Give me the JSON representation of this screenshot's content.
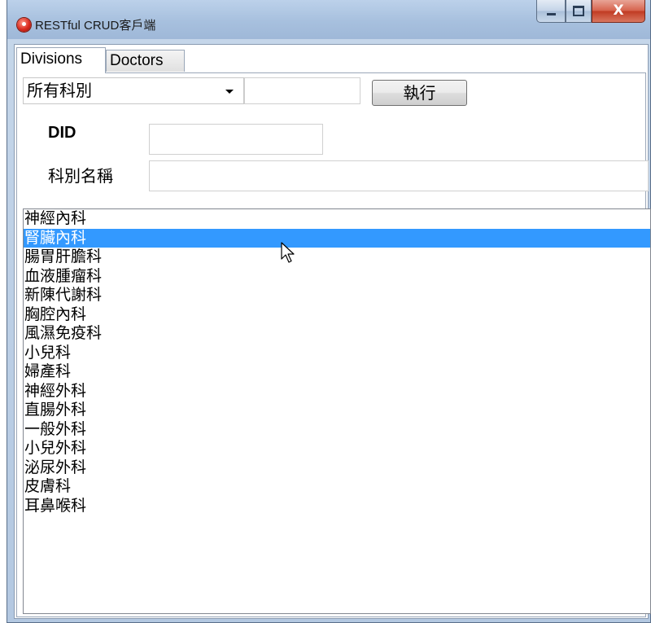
{
  "window": {
    "title": "RESTful CRUD客戶端",
    "controls": {
      "minimize_icon": "minimize-icon",
      "maximize_icon": "maximize-icon",
      "close_label": "X"
    }
  },
  "tabs": [
    {
      "label": "Divisions",
      "active": true
    },
    {
      "label": "Doctors",
      "active": false
    }
  ],
  "toolbar": {
    "division_filter": "所有科別",
    "query_value": "",
    "run_label": "執行"
  },
  "form": {
    "did_label": "DID",
    "did_value": "",
    "name_label": "科別名稱",
    "name_value": ""
  },
  "list": {
    "selected_index": 1,
    "items": [
      "神經內科",
      "腎臟內科",
      "腸胃肝膽科",
      "血液腫瘤科",
      "新陳代謝科",
      "胸腔內科",
      "風濕免疫科",
      "小兒科",
      "婦產科",
      "神經外科",
      "直腸外科",
      "一般外科",
      "小兒外科",
      "泌尿外科",
      "皮膚科",
      "耳鼻喉科"
    ]
  },
  "colors": {
    "selection": "#3399ff",
    "titlebar": "#a7c0de",
    "close_button": "#c03a22"
  }
}
